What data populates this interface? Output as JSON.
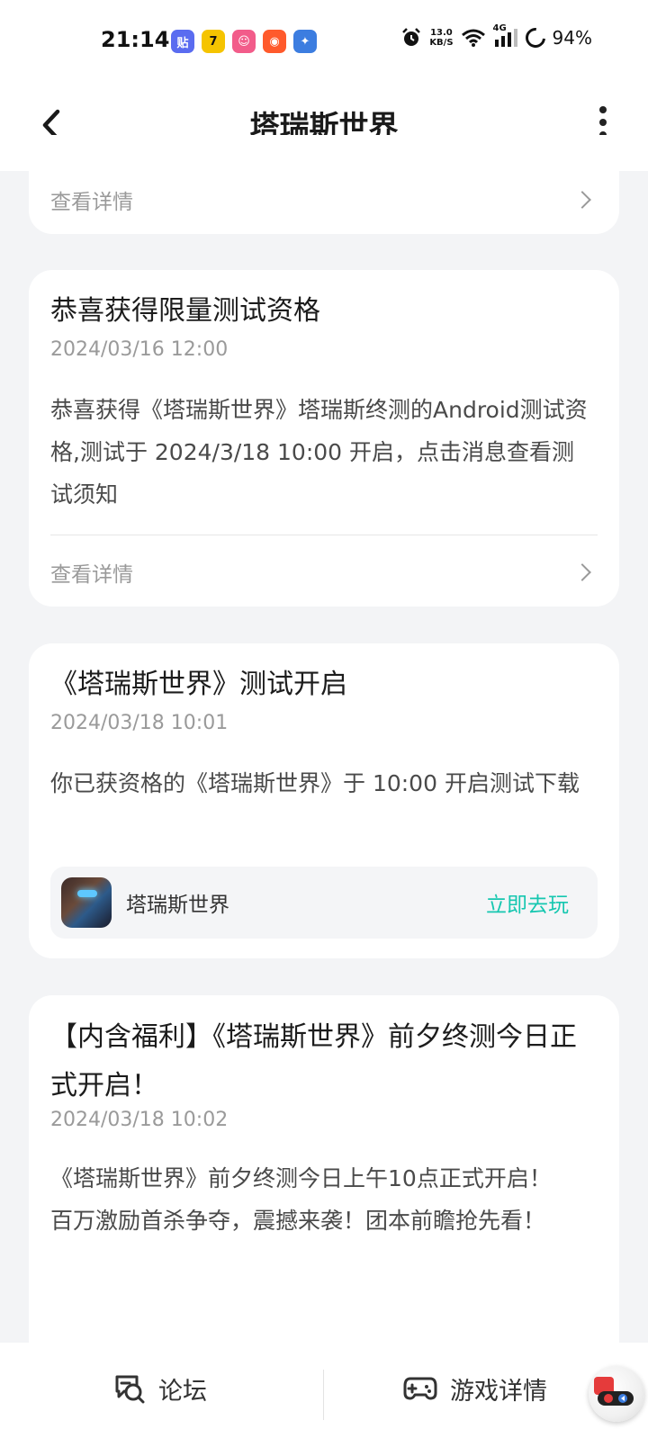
{
  "status_bar": {
    "time": "21:14",
    "app_icons": [
      {
        "name": "tieba-app-icon",
        "glyph": "贴",
        "color": "#5a6cf0"
      },
      {
        "name": "app-7-icon",
        "glyph": "7",
        "color": "#f5c400"
      },
      {
        "name": "pink-app-icon",
        "glyph": "☺",
        "color": "#f25c8a"
      },
      {
        "name": "kuaishou-icon",
        "glyph": "◉",
        "color": "#ff5a2c"
      },
      {
        "name": "game-app-icon",
        "glyph": "✦",
        "color": "#3c7de0"
      }
    ],
    "net_speed_value": "13.0",
    "net_speed_unit": "KB/S",
    "signal_label": "4G",
    "battery": "94%"
  },
  "header": {
    "title": "塔瑞斯世界"
  },
  "cards": [
    {
      "detail_label": "查看详情"
    },
    {
      "title": "恭喜获得限量测试资格",
      "date": "2024/03/16 12:00",
      "body": "恭喜获得《塔瑞斯世界》塔瑞斯终测的Android测试资格,测试于 2024/3/18 10:00 开启，点击消息查看测试须知",
      "detail_label": "查看详情"
    },
    {
      "title": "《塔瑞斯世界》测试开启",
      "date": "2024/03/18 10:01",
      "body": "你已获资格的《塔瑞斯世界》于 10:00 开启测试下载",
      "game_name": "塔瑞斯世界",
      "play_label": "立即去玩"
    },
    {
      "title": "【内含福利】《塔瑞斯世界》前夕终测今日正式开启！",
      "date": "2024/03/18 10:02",
      "body_line1": "《塔瑞斯世界》前夕终测今日上午10点正式开启！",
      "body_line2": "百万激励首杀争夺，震撼来袭！团本前瞻抢先看！"
    }
  ],
  "bottom_bar": {
    "forum_label": "论坛",
    "game_detail_label": "游戏详情"
  },
  "colors": {
    "accent": "#16c7b0",
    "background": "#f3f4f6"
  }
}
